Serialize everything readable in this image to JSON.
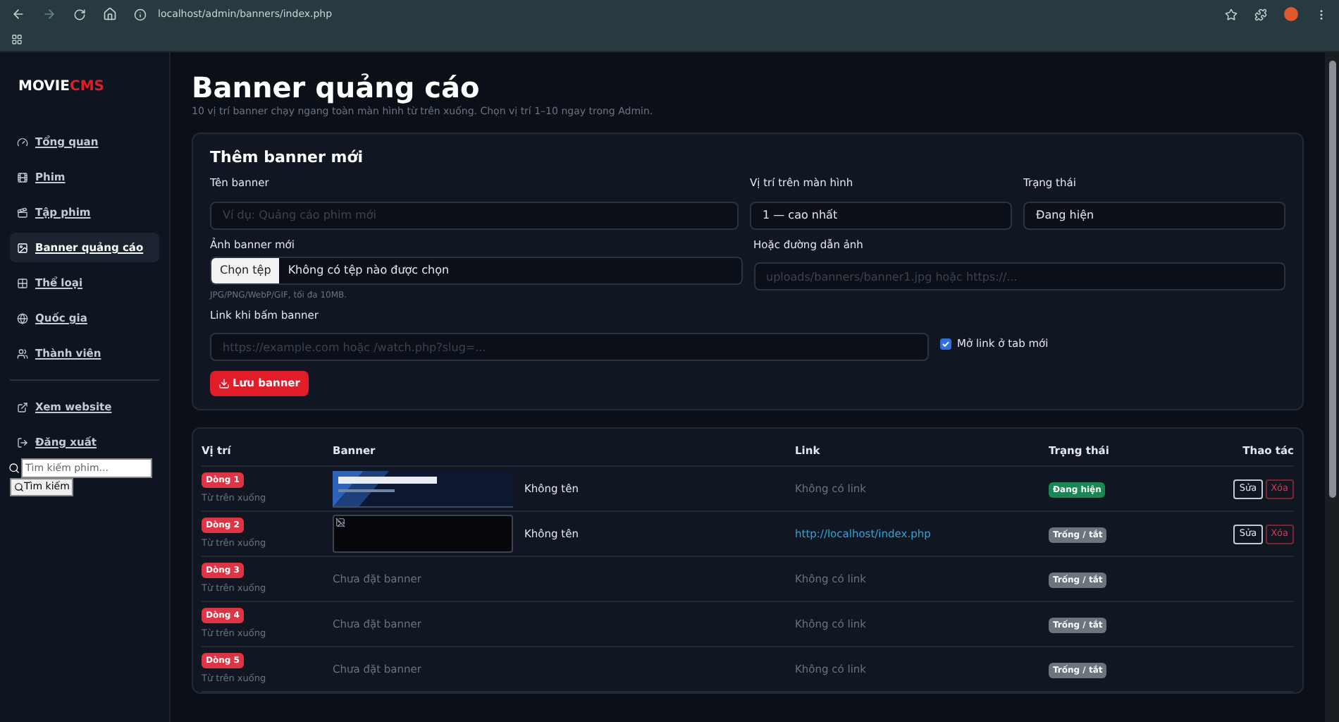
{
  "browser": {
    "url": "localhost/admin/banners/index.php"
  },
  "sidebar": {
    "logo": [
      "MOVIE",
      "CMS"
    ],
    "items": [
      {
        "label": "Tổng quan",
        "selected": false
      },
      {
        "label": "Phim",
        "selected": false
      },
      {
        "label": "Tập phim",
        "selected": false
      },
      {
        "label": "Banner quảng cáo",
        "selected": true
      },
      {
        "label": "Thể loại",
        "selected": false
      },
      {
        "label": "Quốc gia",
        "selected": false
      },
      {
        "label": "Thành viên",
        "selected": false
      }
    ],
    "footer_items": [
      "Xem website",
      "Đăng xuất"
    ],
    "search": {
      "placeholder": "Tìm kiếm phim...",
      "button": "Tìm kiếm"
    }
  },
  "page": {
    "title": "Banner quảng cáo",
    "subtitle": "10 vị trí banner chạy ngang toàn màn hình từ trên xuống. Chọn vị trí 1–10 ngay trong Admin."
  },
  "form": {
    "title": "Thêm banner mới",
    "name": {
      "label": "Tên banner",
      "placeholder": "Ví dụ: Quảng cáo phim mới"
    },
    "position": {
      "label": "Vị trí trên màn hình",
      "value": "1 — cao nhất"
    },
    "status": {
      "label": "Trạng thái",
      "value": "Đang hiện"
    },
    "image": {
      "label": "Ảnh banner mới",
      "button": "Chọn tệp",
      "value": "Không có tệp nào được chọn",
      "hint": "JPG/PNG/WebP/GIF, tối đa 10MB."
    },
    "image_path": {
      "label": "Hoặc đường dẫn ảnh",
      "placeholder": "uploads/banners/banner1.jpg hoặc https://..."
    },
    "link": {
      "label": "Link khi bấm banner",
      "placeholder": "https://example.com hoặc /watch.php?slug=..."
    },
    "new_tab": {
      "label": "Mở link ở tab mới",
      "checked": true
    },
    "save": "Lưu banner"
  },
  "table": {
    "columns": [
      "Vị trí",
      "Banner",
      "Link",
      "Trạng thái",
      "Thao tác"
    ],
    "rows": [
      {
        "position": "Dòng 1",
        "direction": "Từ trên xuống",
        "banner": {
          "kind": "picture",
          "name": "Không tên"
        },
        "link": {
          "kind": "none",
          "text": "Không có link"
        },
        "status": {
          "label": "Đang hiện",
          "active": true
        },
        "actions": [
          "Sửa",
          "Xóa"
        ]
      },
      {
        "position": "Dòng 2",
        "direction": "Từ trên xuống",
        "banner": {
          "kind": "broken",
          "name": "Không tên"
        },
        "link": {
          "kind": "url",
          "text": "http://localhost/index.php"
        },
        "status": {
          "label": "Trống / tắt",
          "active": false
        },
        "actions": [
          "Sửa",
          "Xóa"
        ]
      },
      {
        "position": "Dòng 3",
        "direction": "Từ trên xuống",
        "banner": {
          "kind": "empty",
          "name": "Chưa đặt banner"
        },
        "link": {
          "kind": "none",
          "text": "Không có link"
        },
        "status": {
          "label": "Trống / tắt",
          "active": false
        }
      },
      {
        "position": "Dòng 4",
        "direction": "Từ trên xuống",
        "banner": {
          "kind": "empty",
          "name": "Chưa đặt banner"
        },
        "link": {
          "kind": "none",
          "text": "Không có link"
        },
        "status": {
          "label": "Trống / tắt",
          "active": false
        }
      },
      {
        "position": "Dòng 5",
        "direction": "Từ trên xuống",
        "banner": {
          "kind": "empty",
          "name": "Chưa đặt banner"
        },
        "link": {
          "kind": "none",
          "text": "Không có link"
        },
        "status": {
          "label": "Trống / tắt",
          "active": false
        }
      }
    ]
  }
}
